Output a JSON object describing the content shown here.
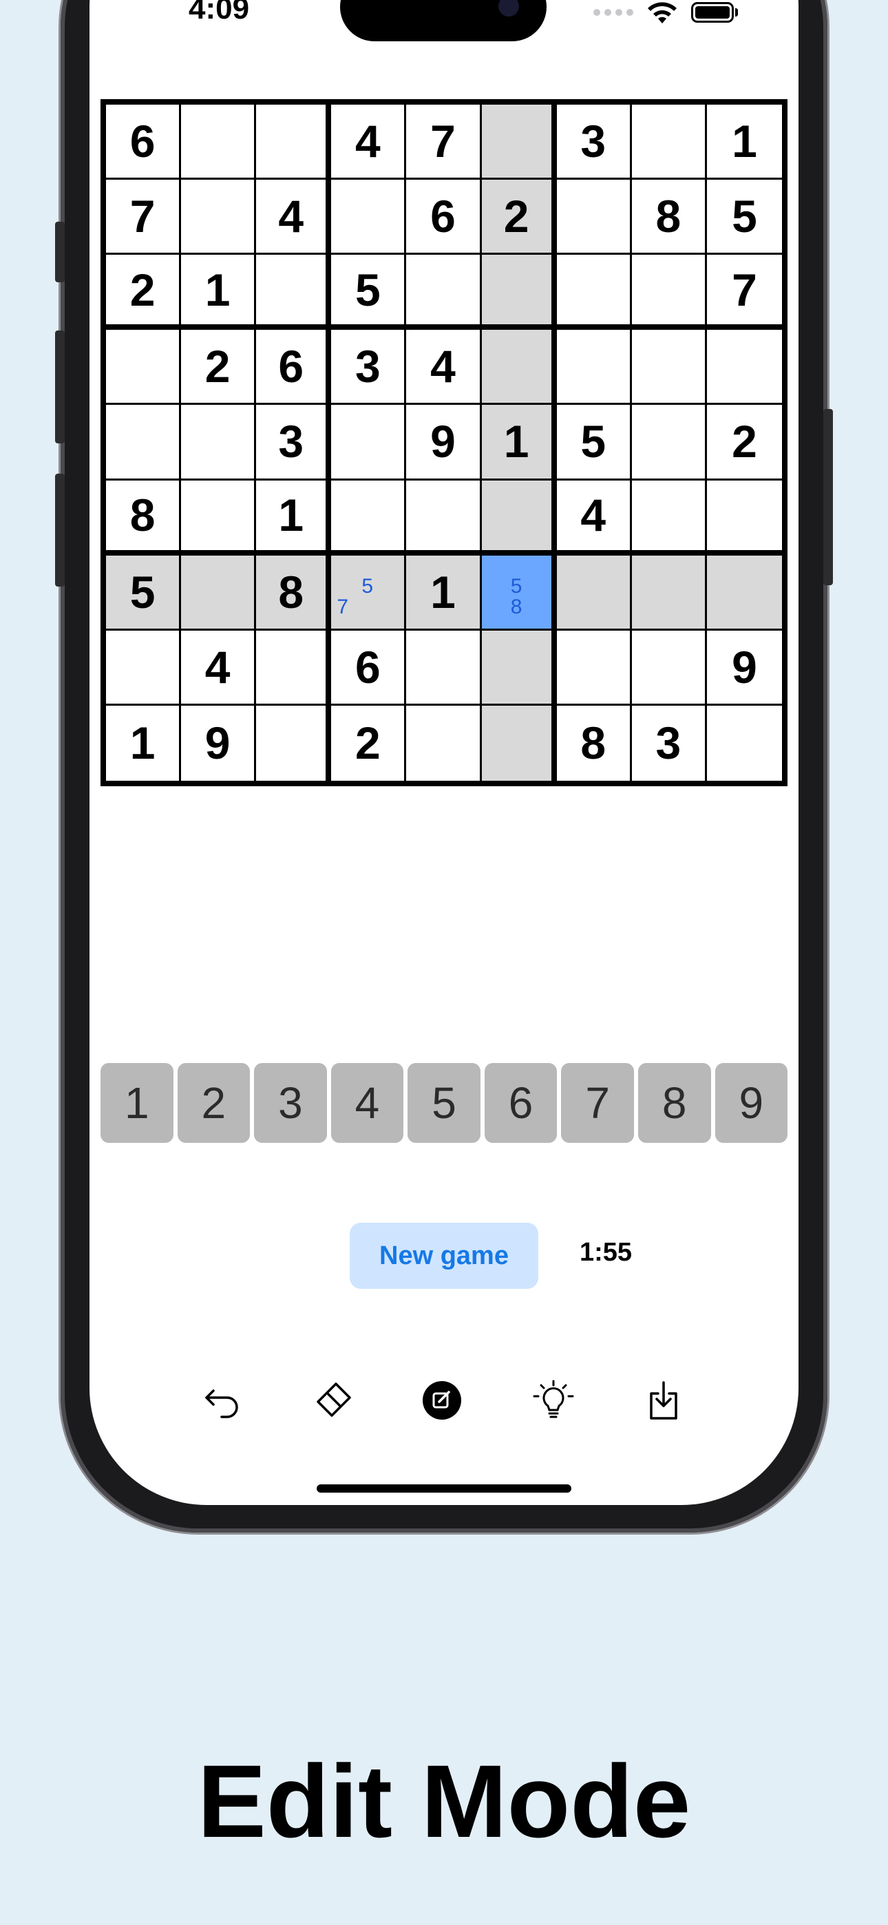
{
  "status_bar": {
    "time": "4:09"
  },
  "board": {
    "rows": [
      [
        "6",
        "",
        "",
        "4",
        "7",
        "",
        "3",
        "",
        "1"
      ],
      [
        "7",
        "",
        "4",
        "",
        "6",
        "2",
        "",
        "8",
        "5"
      ],
      [
        "2",
        "1",
        "",
        "5",
        "",
        "",
        "",
        "",
        "7"
      ],
      [
        "",
        "2",
        "6",
        "3",
        "4",
        "",
        "",
        "",
        ""
      ],
      [
        "",
        "",
        "3",
        "",
        "9",
        "1",
        "5",
        "",
        "2"
      ],
      [
        "8",
        "",
        "1",
        "",
        "",
        "",
        "4",
        "",
        ""
      ],
      [
        "5",
        "",
        "8",
        "",
        "1",
        "",
        "",
        "",
        ""
      ],
      [
        "",
        "4",
        "",
        "6",
        "",
        "",
        "",
        "",
        "9"
      ],
      [
        "1",
        "9",
        "",
        "2",
        "",
        "",
        "8",
        "3",
        ""
      ]
    ],
    "selected": {
      "row": 6,
      "col": 5
    },
    "notes": [
      {
        "row": 6,
        "col": 3,
        "values": [
          "5",
          "7"
        ]
      },
      {
        "row": 6,
        "col": 5,
        "values": [
          "5",
          "8"
        ]
      }
    ]
  },
  "numpad": {
    "keys": [
      "1",
      "2",
      "3",
      "4",
      "5",
      "6",
      "7",
      "8",
      "9"
    ]
  },
  "controls": {
    "new_game_label": "New game",
    "timer": "1:55"
  },
  "toolbar": {
    "icons": [
      "undo-icon",
      "eraser-icon",
      "edit-notes-icon",
      "hint-lightbulb-icon",
      "save-download-icon"
    ]
  },
  "colors": {
    "background": "#e3eff7",
    "selected_cell": "#6ba7ff",
    "highlight_cell": "#d9d9d9",
    "note_text": "#1e5bd8",
    "numpad_key": "#b8b8b8",
    "new_game_bg": "#cfe5ff",
    "new_game_text": "#1679e6"
  },
  "caption": "Edit Mode"
}
